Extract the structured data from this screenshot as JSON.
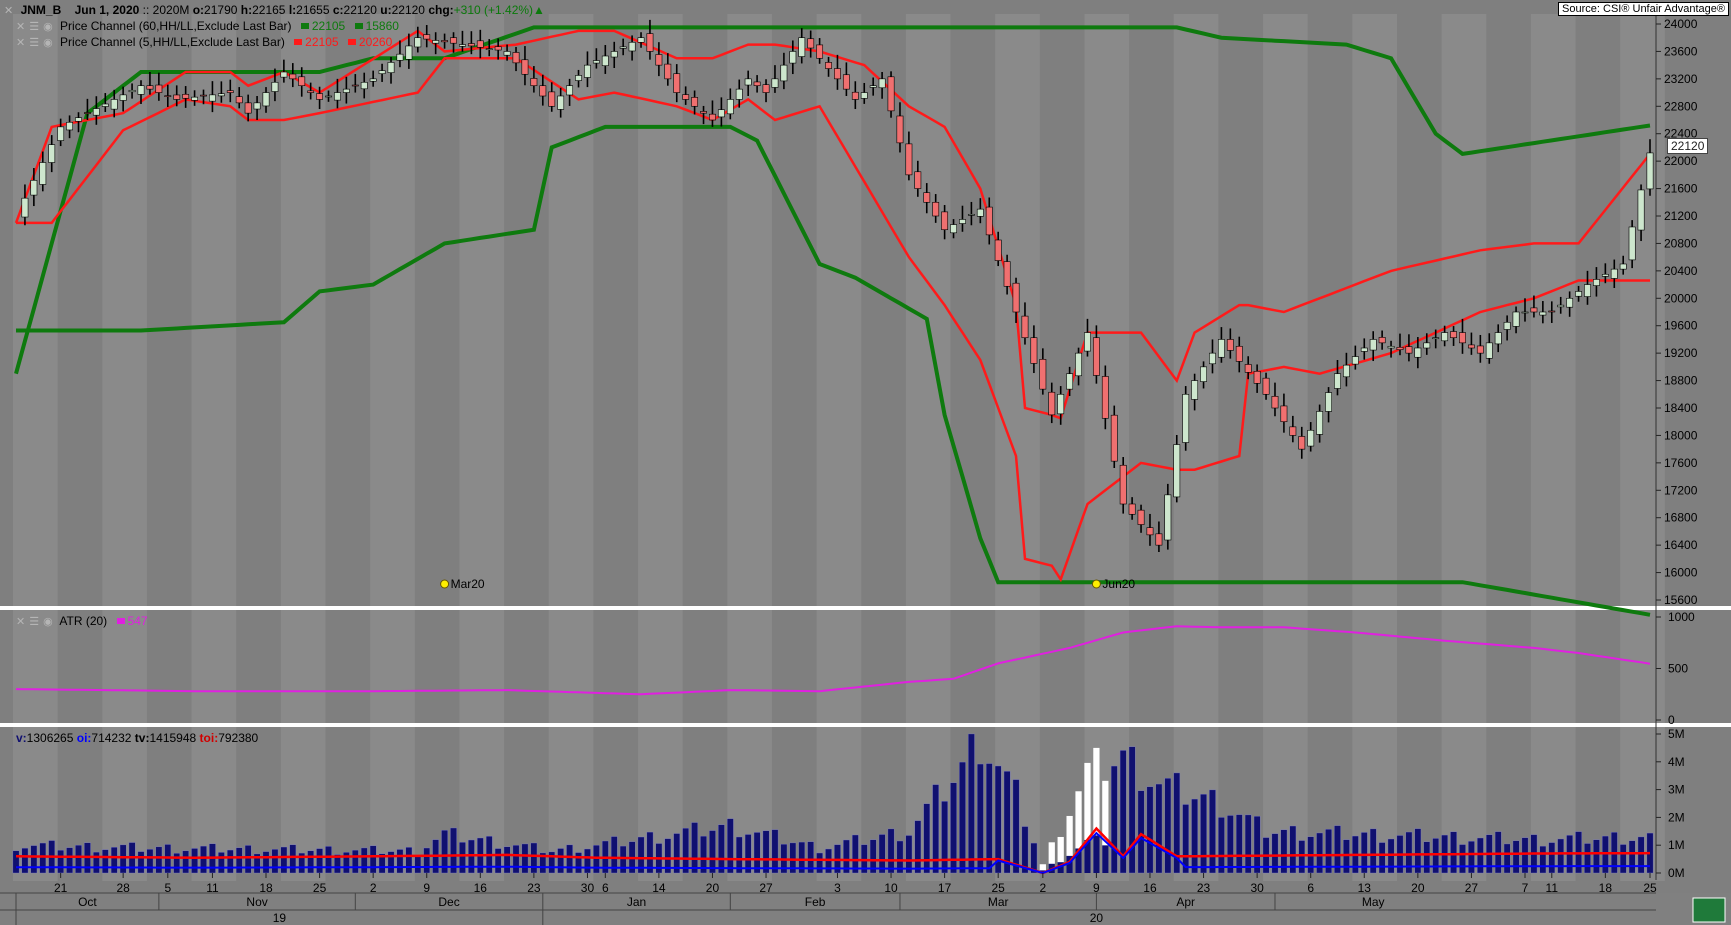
{
  "header": {
    "symbol": "JNM_B",
    "date": "Jun  1, 2020",
    "sep": "::",
    "contract": "2020M",
    "o_label": "o:",
    "o": "21790",
    "h_label": "h:",
    "h": "22165",
    "l_label": "l:",
    "l": "21655",
    "c_label": "c:",
    "c": "22120",
    "u_label": "u:",
    "u": "22120",
    "chg_label": "chg:",
    "chg": "+310 (+1.42%)",
    "source": "Source: CSI® Unfair Advantage®"
  },
  "indicators": {
    "pc60_label": "Price Channel (60,HH/LL,Exclude Last Bar)",
    "pc60_hi": "22105",
    "pc60_lo": "15860",
    "pc5_label": "Price Channel (5,HH/LL,Exclude Last Bar)",
    "pc5_hi": "22105",
    "pc5_lo": "20260",
    "atr_label": "ATR (20)",
    "atr_value": "547",
    "vol_v_label": "v:",
    "vol_v": "1306265",
    "vol_oi_label": "oi:",
    "vol_oi": "714232",
    "vol_tv_label": "tv:",
    "vol_tv": "1415948",
    "vol_toi_label": "toi:",
    "vol_toi": "792380"
  },
  "last_price_tag": "22120",
  "contract_marks": [
    "Mar20",
    "Jun20"
  ],
  "colors": {
    "pc60": "#0e7a0e",
    "pc5": "#ff1a1a",
    "atr": "#e020e0",
    "up": "#cde6cd",
    "down": "#f07070",
    "vol": "#101070",
    "oi": "#ff0000",
    "tvol": "#ffffff",
    "toi": "#0000ff"
  },
  "chart_data": [
    {
      "type": "candlestick",
      "ylim": [
        15600,
        24000
      ],
      "yticks": [
        "24000",
        "23600",
        "23200",
        "22800",
        "22400",
        "22000",
        "21600",
        "21200",
        "20800",
        "20400",
        "20000",
        "19600",
        "19200",
        "18800",
        "18400",
        "18000",
        "17600",
        "17200",
        "16800",
        "16400",
        "16000",
        "15600"
      ],
      "x_day_labels": [
        "21",
        "28",
        "5",
        "11",
        "18",
        "25",
        "2",
        "9",
        "16",
        "23",
        "30",
        "6",
        "14",
        "20",
        "27",
        "3",
        "10",
        "17",
        "25",
        "2",
        "9",
        "16",
        "23",
        "30",
        "6",
        "13",
        "20",
        "27",
        "7",
        "11",
        "18",
        "25"
      ],
      "x_month_labels": [
        "Oct",
        "Nov",
        "Dec",
        "Jan",
        "Feb",
        "Mar",
        "Apr",
        "May"
      ],
      "x_year_labels": [
        "19",
        "20"
      ],
      "series": [
        {
          "name": "Price Channel (60,HH/LL,Exclude Last Bar)",
          "anchors": [
            [
              0,
              18900,
              19530
            ],
            [
              8,
              22700,
              19530
            ],
            [
              14,
              23300,
              19530
            ],
            [
              30,
              23300,
              19650
            ],
            [
              34,
              23300,
              20100
            ],
            [
              40,
              23500,
              20200
            ],
            [
              48,
              23500,
              20800
            ],
            [
              58,
              23950,
              21000
            ],
            [
              60,
              23950,
              22200
            ],
            [
              66,
              23950,
              22500
            ],
            [
              80,
              23950,
              22500
            ],
            [
              83,
              23950,
              22300
            ],
            [
              90,
              23950,
              20500
            ],
            [
              94,
              23950,
              20300
            ],
            [
              102,
              23950,
              19700
            ],
            [
              104,
              23950,
              18300
            ],
            [
              108,
              23950,
              16500
            ],
            [
              110,
              23950,
              15860
            ],
            [
              130,
              23950,
              15860
            ],
            [
              135,
              23800,
              15860
            ],
            [
              149,
              23700,
              15860
            ],
            [
              154,
              23500,
              15860
            ],
            [
              159,
              22400,
              15860
            ],
            [
              162,
              22105,
              15860
            ]
          ]
        },
        {
          "name": "Price Channel (5,HH/LL,Exclude Last Bar)",
          "anchors": [
            [
              0,
              21100,
              21100
            ],
            [
              4,
              22500,
              21100
            ],
            [
              12,
              22700,
              22450
            ],
            [
              19,
              23300,
              22900
            ],
            [
              24,
              23300,
              22800
            ],
            [
              26,
              23100,
              22600
            ],
            [
              30,
              23300,
              22600
            ],
            [
              34,
              23000,
              22700
            ],
            [
              45,
              23900,
              23000
            ],
            [
              48,
              23600,
              23500
            ],
            [
              56,
              23700,
              23500
            ],
            [
              63,
              23900,
              22900
            ],
            [
              67,
              23900,
              23000
            ],
            [
              74,
              23500,
              22800
            ],
            [
              78,
              23500,
              22600
            ],
            [
              82,
              23700,
              22900
            ],
            [
              85,
              23700,
              22600
            ],
            [
              90,
              23600,
              22800
            ],
            [
              95,
              23400,
              21700
            ],
            [
              100,
              22800,
              20600
            ],
            [
              104,
              22500,
              19900
            ],
            [
              108,
              21600,
              19100
            ],
            [
              112,
              19900,
              17700
            ],
            [
              113,
              18400,
              16200
            ],
            [
              116,
              18300,
              16100
            ],
            [
              117,
              18250,
              15900
            ],
            [
              120,
              19500,
              17000
            ],
            [
              126,
              19500,
              17600
            ],
            [
              130,
              18800,
              17500
            ],
            [
              132,
              19500,
              17500
            ],
            [
              137,
              19900,
              17700
            ],
            [
              138,
              19900,
              18900
            ],
            [
              142,
              19800,
              19000
            ],
            [
              146,
              20000,
              18900
            ],
            [
              154,
              20400,
              19200
            ],
            [
              164,
              20700,
              19800
            ],
            [
              170,
              20800,
              20000
            ],
            [
              175,
              20800,
              20260
            ],
            [
              183,
              22105,
              20260
            ]
          ]
        },
        {
          "name": "OHLC",
          "path_close": [
            [
              0,
              21200
            ],
            [
              5,
              22500
            ],
            [
              14,
              23100
            ],
            [
              18,
              22900
            ],
            [
              24,
              23000
            ],
            [
              26,
              22700
            ],
            [
              30,
              23300
            ],
            [
              34,
              22900
            ],
            [
              40,
              23200
            ],
            [
              45,
              23800
            ],
            [
              50,
              23700
            ],
            [
              55,
              23600
            ],
            [
              58,
              23100
            ],
            [
              60,
              22800
            ],
            [
              64,
              23400
            ],
            [
              70,
              23800
            ],
            [
              74,
              23000
            ],
            [
              78,
              22600
            ],
            [
              82,
              23200
            ],
            [
              84,
              23000
            ],
            [
              88,
              23800
            ],
            [
              94,
              22900
            ],
            [
              97,
              23200
            ],
            [
              100,
              21800
            ],
            [
              104,
              21000
            ],
            [
              108,
              21300
            ],
            [
              112,
              19800
            ],
            [
              116,
              18300
            ],
            [
              120,
              19500
            ],
            [
              124,
              17000
            ],
            [
              128,
              16400
            ],
            [
              131,
              18600
            ],
            [
              135,
              19400
            ],
            [
              140,
              18600
            ],
            [
              144,
              17800
            ],
            [
              148,
              18900
            ],
            [
              152,
              19400
            ],
            [
              156,
              19200
            ],
            [
              160,
              19500
            ],
            [
              164,
              19200
            ],
            [
              168,
              19800
            ],
            [
              172,
              19800
            ],
            [
              176,
              20200
            ],
            [
              180,
              20500
            ],
            [
              183,
              22120
            ]
          ]
        }
      ]
    },
    {
      "type": "line",
      "ylim": [
        0,
        1000
      ],
      "yticks": [
        "1000",
        "500",
        "0"
      ],
      "series": [
        {
          "name": "ATR (20)",
          "anchors": [
            [
              0,
              300
            ],
            [
              20,
              280
            ],
            [
              40,
              280
            ],
            [
              55,
              290
            ],
            [
              70,
              250
            ],
            [
              80,
              290
            ],
            [
              90,
              280
            ],
            [
              100,
              370
            ],
            [
              105,
              400
            ],
            [
              110,
              550
            ],
            [
              118,
              700
            ],
            [
              124,
              850
            ],
            [
              130,
              910
            ],
            [
              135,
              900
            ],
            [
              142,
              900
            ],
            [
              150,
              850
            ],
            [
              160,
              770
            ],
            [
              170,
              700
            ],
            [
              175,
              650
            ],
            [
              183,
              547
            ]
          ]
        }
      ]
    },
    {
      "type": "bar",
      "ylim": [
        0,
        5000000
      ],
      "yticks": [
        "5M",
        "4M",
        "3M",
        "2M",
        "1M",
        "0M"
      ],
      "series": [
        {
          "name": "v",
          "anchors": [
            [
              0,
              1000000
            ],
            [
              15,
              900000
            ],
            [
              30,
              850000
            ],
            [
              45,
              800000
            ],
            [
              48,
              1400000
            ],
            [
              60,
              800000
            ],
            [
              65,
              1000000
            ],
            [
              80,
              1700000
            ],
            [
              90,
              900000
            ],
            [
              100,
              1500000
            ],
            [
              106,
              3800000
            ],
            [
              108,
              4900000
            ],
            [
              112,
              2800000
            ],
            [
              115,
              300000
            ],
            [
              120,
              3600000
            ],
            [
              124,
              4200000
            ],
            [
              128,
              3200000
            ],
            [
              135,
              2500000
            ],
            [
              140,
              1500000
            ],
            [
              150,
              1400000
            ],
            [
              160,
              1300000
            ],
            [
              170,
              1200000
            ],
            [
              183,
              1306265
            ]
          ]
        },
        {
          "name": "oi",
          "anchors": [
            [
              0,
              600000
            ],
            [
              20,
              550000
            ],
            [
              40,
              600000
            ],
            [
              55,
              650000
            ],
            [
              65,
              550000
            ],
            [
              80,
              500000
            ],
            [
              100,
              450000
            ],
            [
              110,
              500000
            ],
            [
              115,
              0
            ],
            [
              118,
              400000
            ],
            [
              121,
              1600000
            ],
            [
              124,
              600000
            ],
            [
              126,
              1400000
            ],
            [
              130,
              600000
            ],
            [
              150,
              650000
            ],
            [
              170,
              700000
            ],
            [
              183,
              714232
            ]
          ]
        }
      ]
    }
  ]
}
